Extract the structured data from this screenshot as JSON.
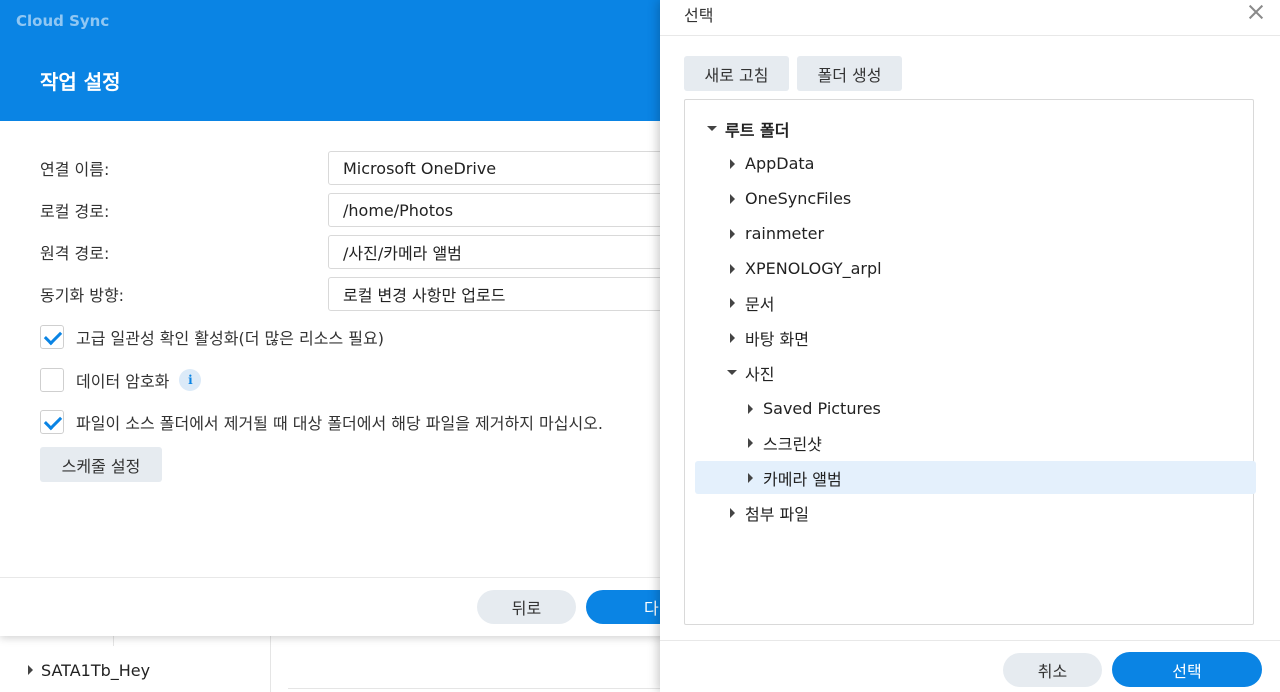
{
  "background": {
    "tree_item": "SATA1Tb_Hey"
  },
  "task_dialog": {
    "app_name": "Cloud Sync",
    "title": "작업 설정",
    "fields": {
      "connection_name": {
        "label": "연결 이름:",
        "value": "Microsoft OneDrive"
      },
      "local_path": {
        "label": "로컬 경로:",
        "value": "/home/Photos"
      },
      "remote_path": {
        "label": "원격 경로:",
        "value": "/사진/카메라 앨범"
      },
      "sync_direction": {
        "label": "동기화 방향:",
        "value": "로컬 변경 사항만 업로드"
      }
    },
    "options": {
      "advanced_consistency": {
        "label": "고급 일관성 확인 활성화(더 많은 리소스 필요)",
        "checked": true
      },
      "data_encryption": {
        "label": "데이터 암호화",
        "checked": false
      },
      "dont_remove": {
        "label": "파일이 소스 폴더에서 제거될 때 대상 폴더에서 해당 파일을 제거하지 마십시오.",
        "checked": true
      }
    },
    "schedule_button": "스케줄 설정",
    "back_button": "뒤로",
    "next_button": "다"
  },
  "select_dialog": {
    "title": "선택",
    "refresh_button": "새로 고침",
    "create_folder_button": "폴더 생성",
    "tree": {
      "root": "루트 폴더",
      "items": [
        "AppData",
        "OneSyncFiles",
        "rainmeter",
        "XPENOLOGY_arpl",
        "문서",
        "바탕 화면",
        "사진",
        "첨부 파일"
      ],
      "photos_children": [
        "Saved Pictures",
        "스크린샷",
        "카메라 앨범"
      ],
      "selected": "카메라 앨범"
    },
    "cancel_button": "취소",
    "select_button": "선택"
  },
  "colors": {
    "accent": "#0a84e4",
    "selected_row": "#e4f0fc",
    "secondary_button": "#e6ebf0"
  }
}
